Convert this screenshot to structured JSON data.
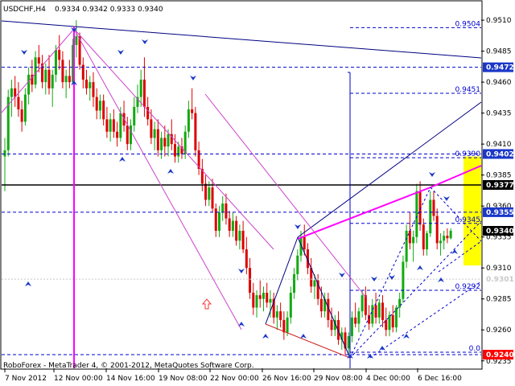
{
  "header": {
    "symbol": "USDCHF,H4",
    "prices": "0.9334 0.9342 0.9333 0.9340"
  },
  "footer": {
    "copyright": "RoboForex - MetaTrader 4, © 2001-2012, MetaQuotes Software Corp."
  },
  "colors": {
    "bull": "#11aa11",
    "bear": "#dd0000",
    "fib": "#0000cc",
    "trend": "#ff00ff",
    "channel": "#cc44cc",
    "navy": "#000080",
    "support": "#000000",
    "target_zone": "#ffff00",
    "arrow": "#1a37c8",
    "tag_bg": "#1a37c8",
    "tag_black": "#000000",
    "tag_red": "#ff0000"
  },
  "chart_data": {
    "type": "candlestick",
    "instrument": "USDCHF",
    "timeframe": "H4",
    "ylim": [
      0.9229,
      0.9525
    ],
    "y_ticks": [
      "0.9510",
      "0.9485",
      "0.9460",
      "0.9435",
      "0.9410",
      "0.9385",
      "0.9360",
      "0.9335",
      "0.9310",
      "0.9285",
      "0.9260",
      "0.9235"
    ],
    "x_ticks": [
      "7 Nov 2012",
      "12 Nov 00:00",
      "14 Nov 16:00",
      "19 Nov 08:00",
      "22 Nov 00:00",
      "26 Nov 16:00",
      "29 Nov 08:00",
      "4 Dec 00:00",
      "6 Dec 16:00"
    ],
    "fibonacci_labels": [
      {
        "text": "0.9504",
        "price": 0.9504
      },
      {
        "text": "0.9451",
        "price": 0.9451
      },
      {
        "text": "0.9390",
        "price": 0.9399
      },
      {
        "text": "0.9345",
        "price": 0.9346
      },
      {
        "text": "0.9292",
        "price": 0.9292
      },
      {
        "text": "0.0",
        "price": 0.9242
      }
    ],
    "price_tags": [
      {
        "text": "0.9472",
        "price": 0.9472,
        "style": "blue"
      },
      {
        "text": "0.9402",
        "price": 0.9402,
        "style": "blue"
      },
      {
        "text": "0.9377",
        "price": 0.9377,
        "style": "black"
      },
      {
        "text": "0.9355",
        "price": 0.9355,
        "style": "blue"
      },
      {
        "text": "0.9340",
        "price": 0.934,
        "style": "black"
      },
      {
        "text": "0.9301",
        "price": 0.9301,
        "style": "faded"
      },
      {
        "text": "0.9240",
        "price": 0.924,
        "style": "red"
      }
    ],
    "support_line": 0.9377,
    "target_zone": [
      0.9312,
      0.94
    ],
    "candles": [
      [
        0.94,
        0.9415,
        0.9372,
        0.9405
      ],
      [
        0.9405,
        0.9454,
        0.94,
        0.9448
      ],
      [
        0.9448,
        0.9462,
        0.9432,
        0.9455
      ],
      [
        0.9455,
        0.9465,
        0.944,
        0.9448
      ],
      [
        0.9448,
        0.946,
        0.9432,
        0.9438
      ],
      [
        0.9438,
        0.9445,
        0.942,
        0.9428
      ],
      [
        0.9428,
        0.9455,
        0.9425,
        0.945
      ],
      [
        0.945,
        0.9472,
        0.9442,
        0.9466
      ],
      [
        0.9466,
        0.9478,
        0.9452,
        0.9458
      ],
      [
        0.9458,
        0.9485,
        0.9455,
        0.948
      ],
      [
        0.948,
        0.949,
        0.9468,
        0.9475
      ],
      [
        0.9475,
        0.9482,
        0.9455,
        0.946
      ],
      [
        0.946,
        0.9475,
        0.945,
        0.947
      ],
      [
        0.947,
        0.9482,
        0.945,
        0.9455
      ],
      [
        0.9455,
        0.947,
        0.944,
        0.9466
      ],
      [
        0.9466,
        0.949,
        0.946,
        0.9486
      ],
      [
        0.9486,
        0.9498,
        0.947,
        0.9478
      ],
      [
        0.9478,
        0.9485,
        0.9455,
        0.946
      ],
      [
        0.946,
        0.947,
        0.9447,
        0.9465
      ],
      [
        0.9465,
        0.9478,
        0.9455,
        0.946
      ],
      [
        0.946,
        0.9495,
        0.9458,
        0.949
      ],
      [
        0.949,
        0.951,
        0.948,
        0.9497
      ],
      [
        0.9497,
        0.95,
        0.947,
        0.9474
      ],
      [
        0.9474,
        0.948,
        0.9455,
        0.9462
      ],
      [
        0.9462,
        0.947,
        0.945,
        0.9455
      ],
      [
        0.9455,
        0.9465,
        0.9445,
        0.946
      ],
      [
        0.946,
        0.9468,
        0.944,
        0.9448
      ],
      [
        0.9448,
        0.9455,
        0.943,
        0.9437
      ],
      [
        0.9437,
        0.945,
        0.943,
        0.9445
      ],
      [
        0.9445,
        0.945,
        0.9425,
        0.943
      ],
      [
        0.943,
        0.944,
        0.9415,
        0.942
      ],
      [
        0.942,
        0.9435,
        0.9412,
        0.943
      ],
      [
        0.943,
        0.9438,
        0.9415,
        0.942
      ],
      [
        0.942,
        0.9428,
        0.9408,
        0.9415
      ],
      [
        0.9415,
        0.944,
        0.9412,
        0.9435
      ],
      [
        0.9435,
        0.9445,
        0.942,
        0.9425
      ],
      [
        0.9425,
        0.9432,
        0.9405,
        0.941
      ],
      [
        0.941,
        0.943,
        0.9405,
        0.9425
      ],
      [
        0.9425,
        0.9448,
        0.942,
        0.944
      ],
      [
        0.944,
        0.9458,
        0.9435,
        0.9448
      ],
      [
        0.9448,
        0.947,
        0.944,
        0.9462
      ],
      [
        0.9462,
        0.948,
        0.9432,
        0.944
      ],
      [
        0.944,
        0.9448,
        0.9425,
        0.943
      ],
      [
        0.943,
        0.9438,
        0.941,
        0.9415
      ],
      [
        0.9415,
        0.9428,
        0.9405,
        0.9422
      ],
      [
        0.9422,
        0.943,
        0.94,
        0.9405
      ],
      [
        0.9405,
        0.942,
        0.9398,
        0.9415
      ],
      [
        0.9415,
        0.9425,
        0.94,
        0.9408
      ],
      [
        0.9408,
        0.9422,
        0.94,
        0.9418
      ],
      [
        0.9418,
        0.943,
        0.9405,
        0.941
      ],
      [
        0.941,
        0.9418,
        0.9395,
        0.94
      ],
      [
        0.94,
        0.9412,
        0.9395,
        0.9408
      ],
      [
        0.9408,
        0.9415,
        0.9398,
        0.9402
      ],
      [
        0.9402,
        0.9425,
        0.9398,
        0.942
      ],
      [
        0.942,
        0.9445,
        0.9415,
        0.9438
      ],
      [
        0.9438,
        0.9455,
        0.943,
        0.9435
      ],
      [
        0.9435,
        0.944,
        0.94,
        0.9405
      ],
      [
        0.9405,
        0.9412,
        0.9385,
        0.939
      ],
      [
        0.939,
        0.9398,
        0.9372,
        0.9378
      ],
      [
        0.9378,
        0.9385,
        0.936,
        0.9365
      ],
      [
        0.9365,
        0.938,
        0.936,
        0.9375
      ],
      [
        0.9375,
        0.9382,
        0.9355,
        0.9358
      ],
      [
        0.9358,
        0.9362,
        0.9335,
        0.934
      ],
      [
        0.934,
        0.936,
        0.9335,
        0.9355
      ],
      [
        0.9355,
        0.9368,
        0.9348,
        0.9362
      ],
      [
        0.9362,
        0.937,
        0.9345,
        0.935
      ],
      [
        0.935,
        0.9356,
        0.9335,
        0.934
      ],
      [
        0.934,
        0.9355,
        0.9335,
        0.9348
      ],
      [
        0.9348,
        0.9352,
        0.9328,
        0.9332
      ],
      [
        0.9332,
        0.9345,
        0.9325,
        0.934
      ],
      [
        0.934,
        0.9348,
        0.9322,
        0.9325
      ],
      [
        0.9325,
        0.9335,
        0.9305,
        0.931
      ],
      [
        0.931,
        0.9318,
        0.9285,
        0.929
      ],
      [
        0.929,
        0.9298,
        0.9272,
        0.9278
      ],
      [
        0.9278,
        0.9292,
        0.927,
        0.9288
      ],
      [
        0.9288,
        0.93,
        0.9278,
        0.9285
      ],
      [
        0.9285,
        0.9295,
        0.9275,
        0.929
      ],
      [
        0.929,
        0.9298,
        0.9278,
        0.9282
      ],
      [
        0.9282,
        0.9292,
        0.927,
        0.9285
      ],
      [
        0.9285,
        0.929,
        0.9265,
        0.927
      ],
      [
        0.927,
        0.928,
        0.926,
        0.9275
      ],
      [
        0.9275,
        0.9282,
        0.9262,
        0.9268
      ],
      [
        0.9268,
        0.9275,
        0.9252,
        0.9258
      ],
      [
        0.9258,
        0.9275,
        0.9255,
        0.927
      ],
      [
        0.927,
        0.9295,
        0.9265,
        0.929
      ],
      [
        0.929,
        0.931,
        0.9285,
        0.9305
      ],
      [
        0.9305,
        0.9325,
        0.93,
        0.932
      ],
      [
        0.932,
        0.934,
        0.9315,
        0.9335
      ],
      [
        0.9335,
        0.9345,
        0.932,
        0.9325
      ],
      [
        0.9325,
        0.933,
        0.9305,
        0.931
      ],
      [
        0.931,
        0.9318,
        0.929,
        0.9295
      ],
      [
        0.9295,
        0.9305,
        0.9285,
        0.93
      ],
      [
        0.93,
        0.9305,
        0.928,
        0.9285
      ],
      [
        0.9285,
        0.9295,
        0.927,
        0.9275
      ],
      [
        0.9275,
        0.929,
        0.927,
        0.9285
      ],
      [
        0.9285,
        0.929,
        0.9262,
        0.9268
      ],
      [
        0.9268,
        0.9278,
        0.9255,
        0.926
      ],
      [
        0.926,
        0.9272,
        0.9255,
        0.9268
      ],
      [
        0.9268,
        0.9275,
        0.9248,
        0.9252
      ],
      [
        0.9252,
        0.9262,
        0.9244,
        0.9258
      ],
      [
        0.9258,
        0.9262,
        0.924,
        0.9245
      ],
      [
        0.9245,
        0.9258,
        0.924,
        0.9255
      ],
      [
        0.9255,
        0.9275,
        0.925,
        0.927
      ],
      [
        0.927,
        0.9282,
        0.9262,
        0.9265
      ],
      [
        0.9265,
        0.9278,
        0.9258,
        0.9275
      ],
      [
        0.9275,
        0.9292,
        0.927,
        0.9288
      ],
      [
        0.9288,
        0.9295,
        0.9268,
        0.9272
      ],
      [
        0.9272,
        0.928,
        0.926,
        0.9265
      ],
      [
        0.9265,
        0.9285,
        0.9262,
        0.928
      ],
      [
        0.928,
        0.929,
        0.9265,
        0.927
      ],
      [
        0.927,
        0.9285,
        0.9265,
        0.9282
      ],
      [
        0.9282,
        0.9288,
        0.9262,
        0.9268
      ],
      [
        0.9268,
        0.9278,
        0.9255,
        0.926
      ],
      [
        0.926,
        0.9275,
        0.9255,
        0.9272
      ],
      [
        0.9272,
        0.928,
        0.9258,
        0.9262
      ],
      [
        0.9262,
        0.928,
        0.9258,
        0.9278
      ],
      [
        0.9278,
        0.929,
        0.927,
        0.9285
      ],
      [
        0.9285,
        0.932,
        0.9282,
        0.9315
      ],
      [
        0.9315,
        0.9345,
        0.931,
        0.934
      ],
      [
        0.934,
        0.9355,
        0.9325,
        0.933
      ],
      [
        0.933,
        0.934,
        0.9315,
        0.9335
      ],
      [
        0.9335,
        0.9378,
        0.933,
        0.9372
      ],
      [
        0.9372,
        0.938,
        0.934,
        0.9345
      ],
      [
        0.9345,
        0.935,
        0.932,
        0.9325
      ],
      [
        0.9325,
        0.934,
        0.932,
        0.9338
      ],
      [
        0.9338,
        0.9372,
        0.9335,
        0.9365
      ],
      [
        0.9365,
        0.9372,
        0.9348,
        0.9352
      ],
      [
        0.9352,
        0.9358,
        0.9325,
        0.933
      ],
      [
        0.933,
        0.9338,
        0.932,
        0.9332
      ],
      [
        0.9332,
        0.934,
        0.9325,
        0.9336
      ],
      [
        0.9336,
        0.9342,
        0.933,
        0.9334
      ],
      [
        0.9334,
        0.9342,
        0.9333,
        0.934
      ]
    ]
  }
}
